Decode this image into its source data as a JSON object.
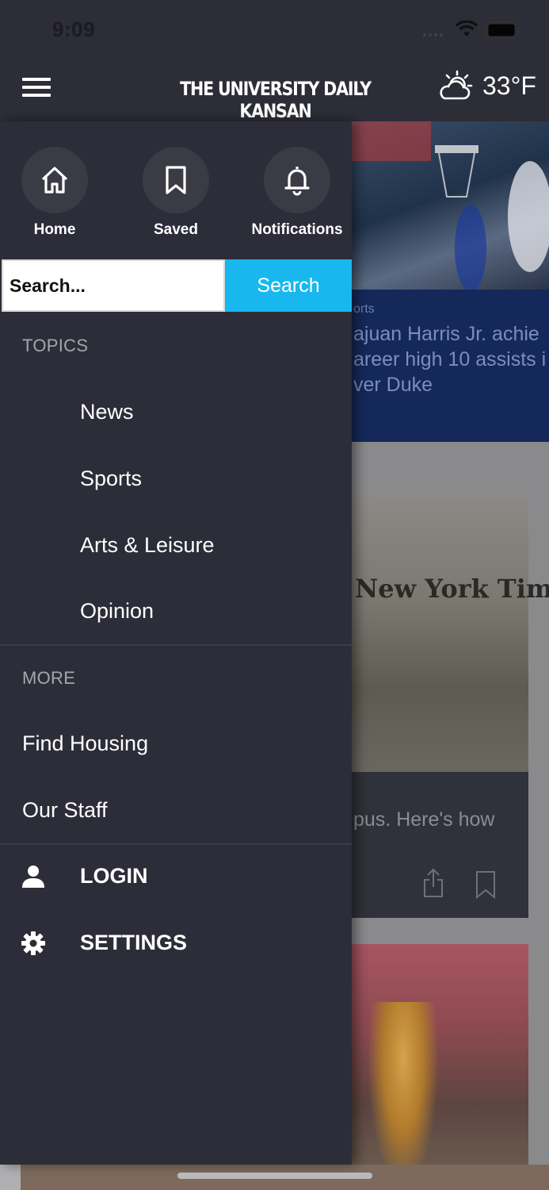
{
  "status": {
    "time": "9:09"
  },
  "header": {
    "title": "THE UNIVERSITY DAILY KANSAN",
    "temperature": "33°F",
    "weather_icon": "partly-cloudy-icon"
  },
  "drawer": {
    "quick_actions": [
      {
        "label": "Home",
        "icon": "home-icon"
      },
      {
        "label": "Saved",
        "icon": "bookmark-icon"
      },
      {
        "label": "Notifications",
        "icon": "bell-icon"
      }
    ],
    "search": {
      "placeholder": "Search...",
      "button_label": "Search"
    },
    "topics_heading": "TOPICS",
    "topics": [
      "News",
      "Sports",
      "Arts & Leisure",
      "Opinion"
    ],
    "more_heading": "MORE",
    "more_items": [
      "Find Housing",
      "Our Staff"
    ],
    "account": [
      {
        "label": "LOGIN",
        "icon": "person-icon"
      },
      {
        "label": "SETTINGS",
        "icon": "gear-icon"
      }
    ]
  },
  "background": {
    "hero_category": "orts",
    "hero_lines": [
      "ajuan Harris Jr. achie",
      "areer high 10 assists i",
      "ver Duke"
    ],
    "card2_text": "pus. Here's how",
    "masthead_text": "New York Times"
  },
  "colors": {
    "accent": "#18b8ef",
    "drawer": "#2c2d38",
    "hero_caption": "#14285a"
  }
}
